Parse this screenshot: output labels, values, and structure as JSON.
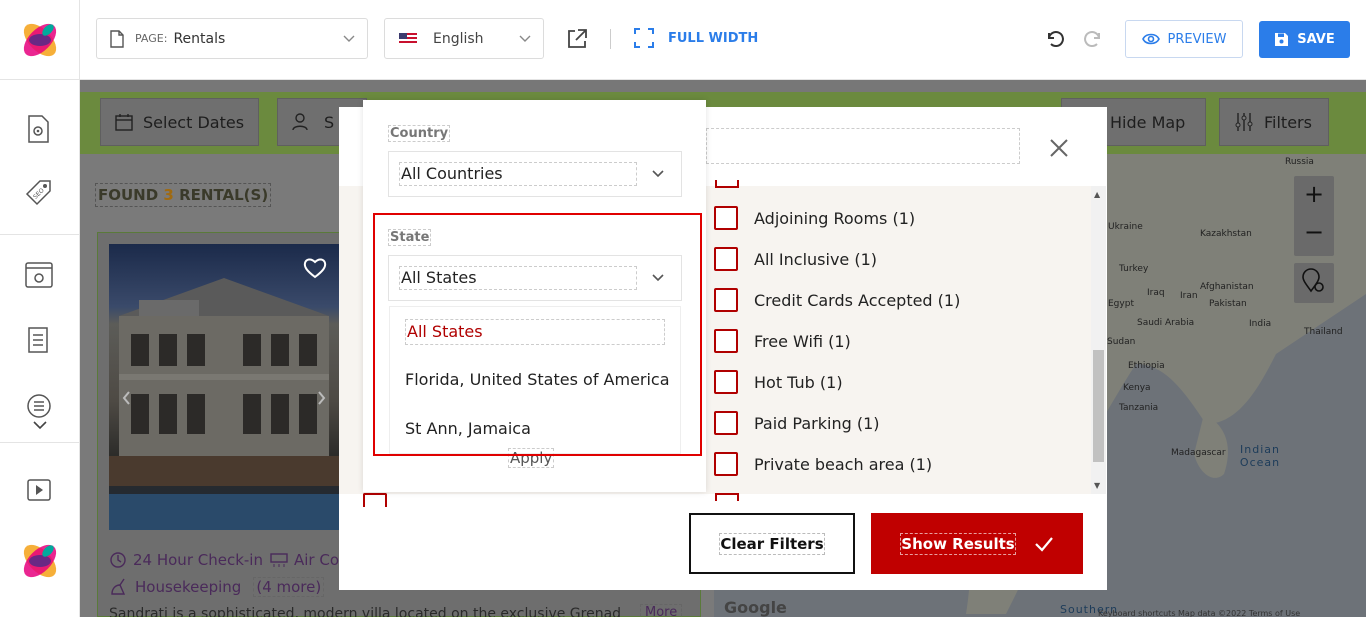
{
  "toolbar": {
    "page_prefix": "PAGE:",
    "page_value": "Rentals",
    "language": "English",
    "full_width_label": "FULL WIDTH",
    "preview_label": "PREVIEW",
    "save_label": "SAVE",
    "accent_color": "#2b7de9"
  },
  "background_page": {
    "select_dates": "Select Dates",
    "guests_partial": "S",
    "hide_map": "Hide Map",
    "filters": "Filters",
    "found_prefix": "FOUND",
    "found_count": "3",
    "found_suffix": "RENTAL(S)",
    "amenity_1": "24 Hour Check-in",
    "amenity_2": "Air Con",
    "amenity_3": "Housekeeping",
    "more_link": "(4 more)",
    "description": "Sandrati is a sophisticated, modern villa located on the exclusive Grenad",
    "more_btn": "More",
    "map": {
      "labels": [
        "Russia",
        "Ukraine",
        "Kazakhstan",
        "Turkey",
        "Iraq",
        "Iran",
        "Afghanistan",
        "Pakistan",
        "Egypt",
        "Saudi Arabia",
        "India",
        "Thailand",
        "Sudan",
        "Ethiopia",
        "Kenya",
        "Tanzania",
        "Madagascar"
      ],
      "ocean": "Indian Ocean",
      "southern": "Southern",
      "google": "Google",
      "footer": "Keyboard shortcuts   Map data ©2022   Terms of Use"
    }
  },
  "modal": {
    "amenities": [
      "Adjoining Rooms (1)",
      "All Inclusive (1)",
      "Credit Cards Accepted (1)",
      "Free Wifi (1)",
      "Hot Tub (1)",
      "Paid Parking (1)",
      "Private beach area (1)"
    ],
    "clear_filters": "Clear Filters",
    "show_results": "Show Results",
    "brand_red": "#c00000"
  },
  "location_popup": {
    "country_label": "Country",
    "country_value": "All Countries",
    "state_label": "State",
    "state_value": "All States",
    "state_options": [
      "All States",
      "Florida, United States of America",
      "St Ann, Jamaica"
    ],
    "apply": "Apply",
    "highlight_color": "#e00000"
  }
}
